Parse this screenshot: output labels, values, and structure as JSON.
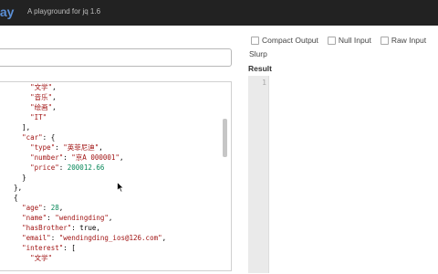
{
  "navbar": {
    "brand": "lay",
    "tagline": "A playground for jq 1.6"
  },
  "filter": {
    "value": "",
    "placeholder": ""
  },
  "options": [
    {
      "label": "Compact Output",
      "checked": false
    },
    {
      "label": "Null Input",
      "checked": false
    },
    {
      "label": "Raw Input",
      "checked": false
    }
  ],
  "slurp_label": "Slurp",
  "result": {
    "label": "Result",
    "line_number": "1"
  },
  "input_lines": [
    "    \"文学\",",
    "    \"音乐\",",
    "    \"绘画\",",
    "    \"IT\"",
    "  ],",
    "  \"car\": {",
    "    \"type\": \"英菲尼迪\",",
    "    \"number\": \"京A 000001\",",
    "    \"price\": 200012.66",
    "  }",
    "},",
    "{",
    "  \"age\": 28,",
    "  \"name\": \"wendingding\",",
    "  \"hasBrother\": true,",
    "  \"email\": \"wendingding_ios@126.com\",",
    "  \"interest\": [",
    "    \"文学\""
  ],
  "colors": {
    "navbar": "#222222",
    "brand": "#5b8fd6",
    "string": "#a11515",
    "number": "#09885a",
    "gutter": "#eaeaea"
  }
}
